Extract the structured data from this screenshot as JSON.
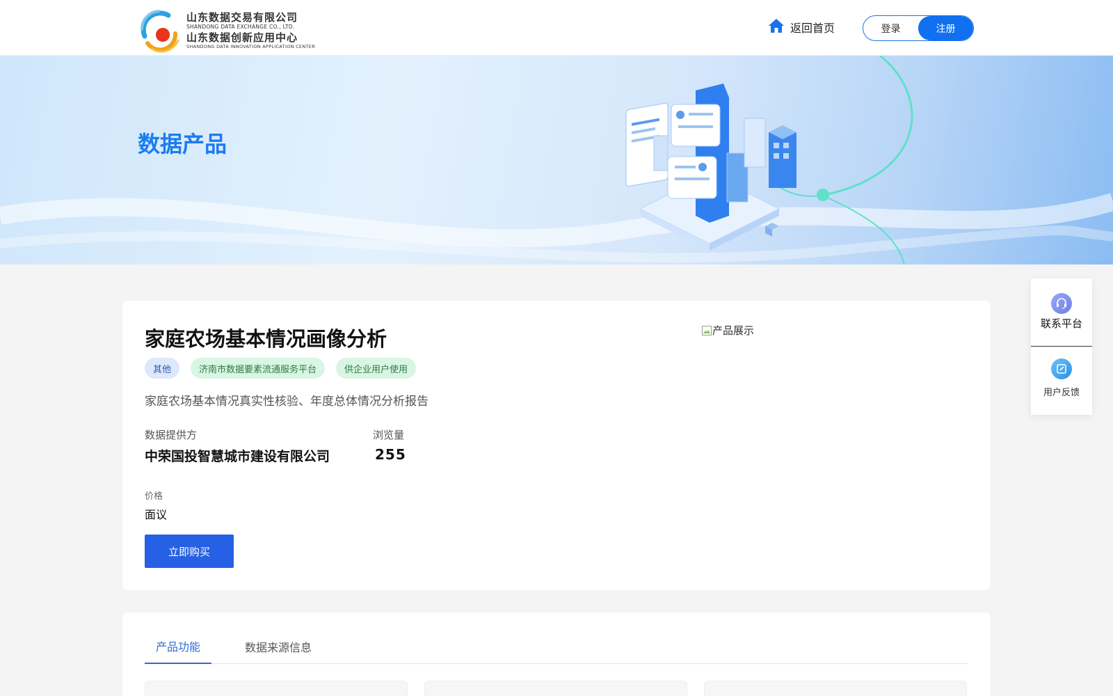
{
  "header": {
    "logo": {
      "company_cn": "山东数据交易有限公司",
      "company_en": "SHANDONG DATA EXCHANGE CO., LTD.",
      "center_cn": "山东数据创新应用中心",
      "center_en": "SHANDONG DATA INNOVATION APPLICATION CENTER"
    },
    "home_label": "返回首页",
    "home_icon": "home-icon",
    "login_label": "登录",
    "register_label": "注册"
  },
  "banner": {
    "title": "数据产品"
  },
  "product": {
    "title": "家庭农场基本情况画像分析",
    "tags": [
      "其他",
      "济南市数据要素流通服务平台",
      "供企业用户使用"
    ],
    "description": "家庭农场基本情况真实性核验、年度总体情况分析报告",
    "supplier_label": "数据提供方",
    "supplier_value": "中荣国投智慧城市建设有限公司",
    "views_label": "浏览量",
    "views_value": "255",
    "price_label": "价格",
    "price_value": "面议",
    "buy_label": "立即购买",
    "image_alt": "产品展示"
  },
  "tabs": [
    {
      "label": "产品功能",
      "active": true
    },
    {
      "label": "数据来源信息",
      "active": false
    }
  ],
  "side_panel": {
    "contact_label": "联系平台",
    "contact_icon": "headset-icon",
    "feedback_label": "用户反馈",
    "feedback_icon": "edit-icon"
  },
  "colors": {
    "primary": "#1170f0",
    "banner_title": "#1a7cf0",
    "buy_button": "#2660e4",
    "tag_blue_bg": "#dce8fb",
    "tag_green_bg": "#d9f5e3"
  }
}
